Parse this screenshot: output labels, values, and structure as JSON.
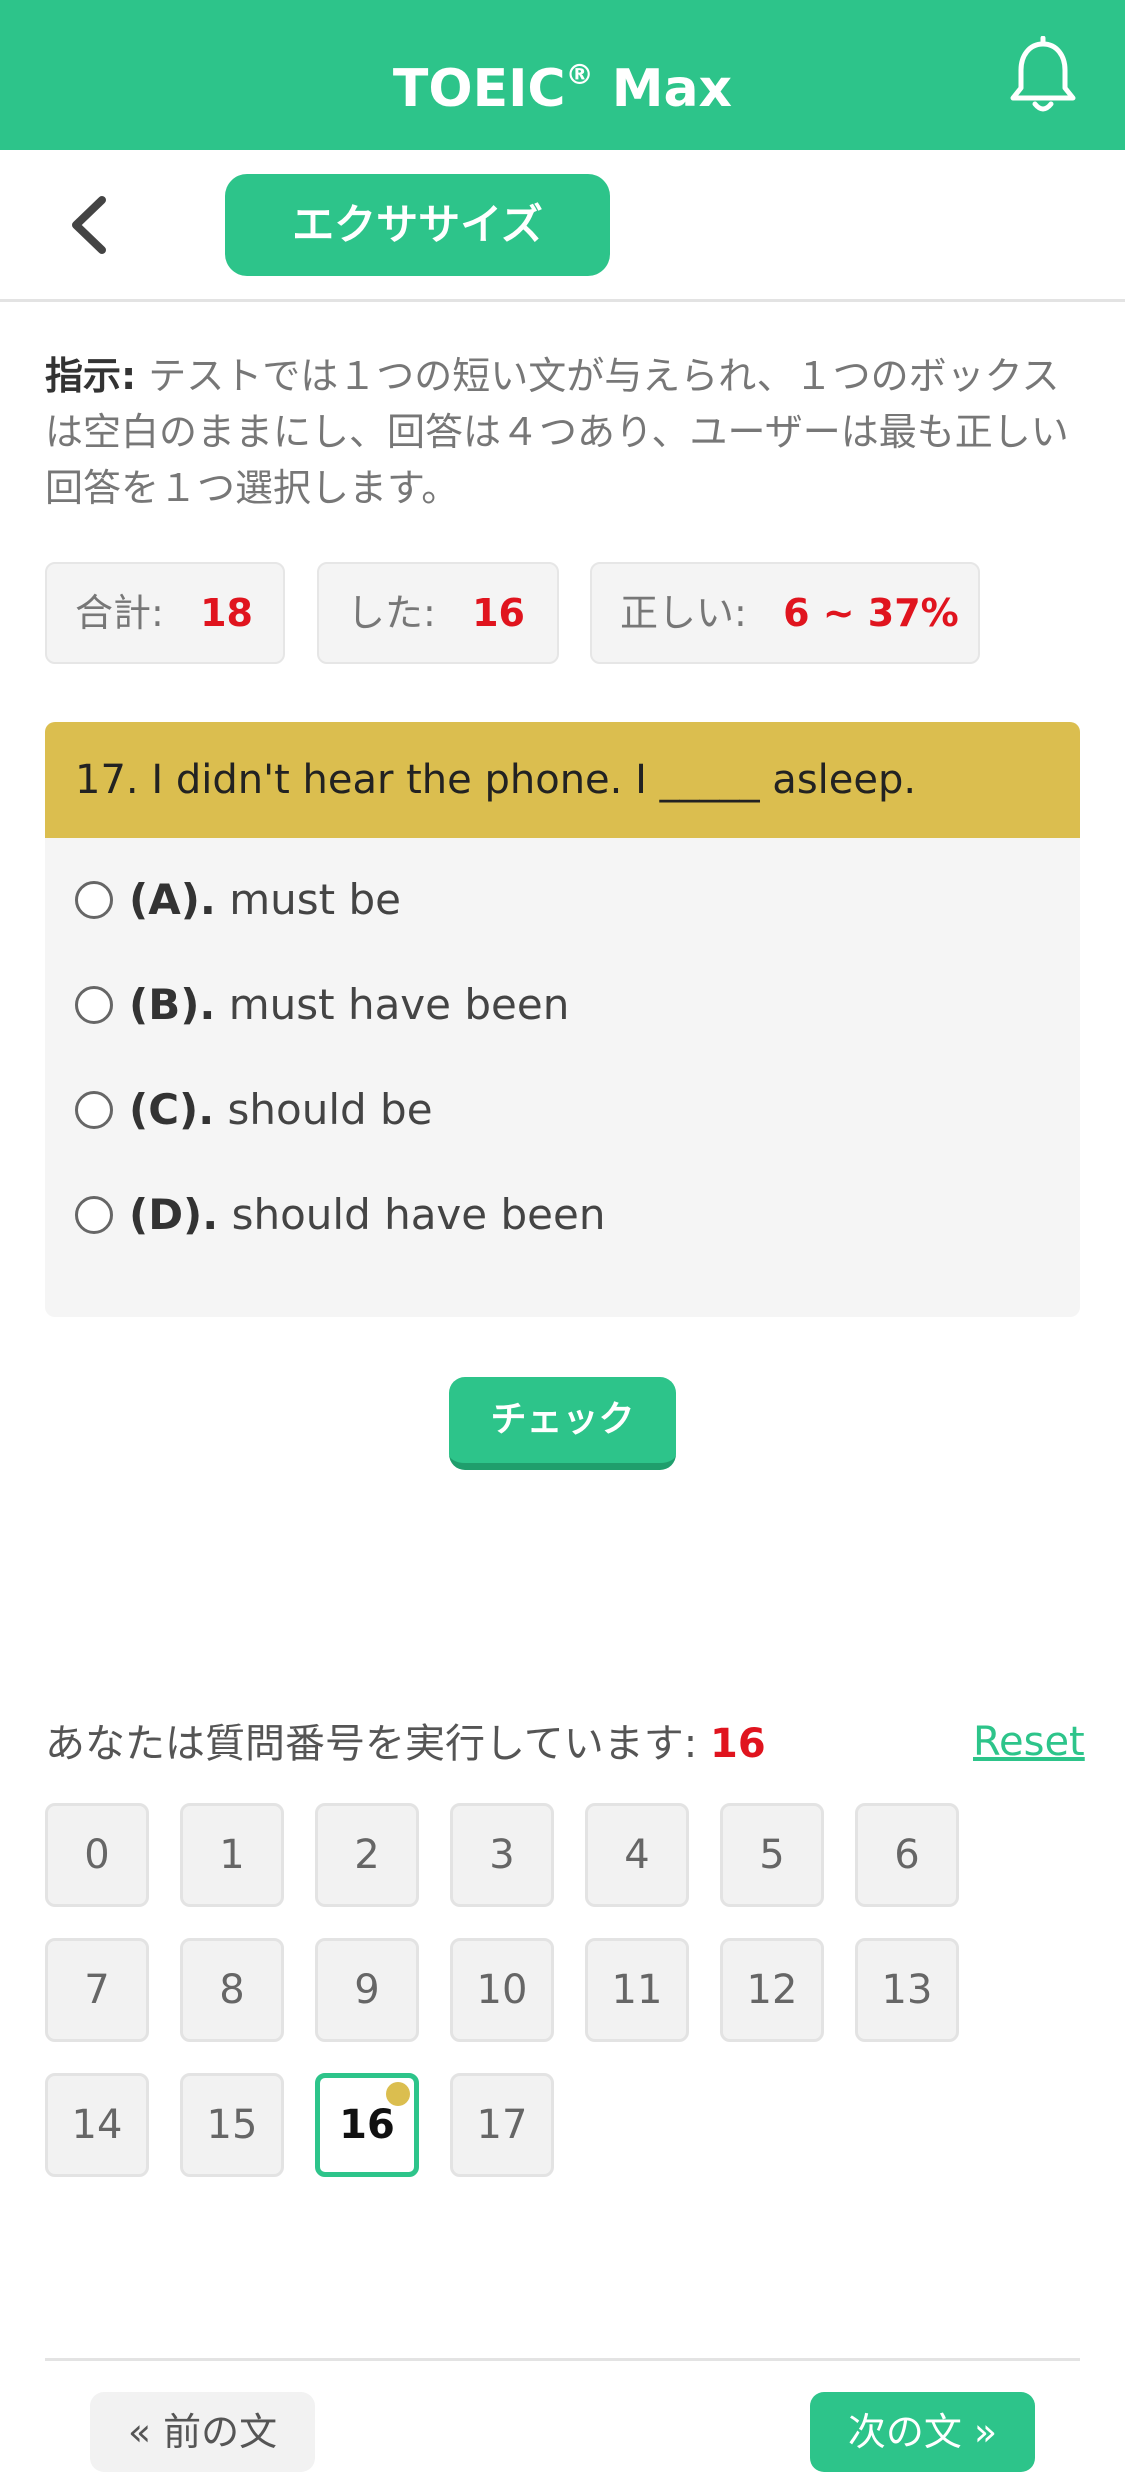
{
  "header": {
    "title": "TOEIC",
    "title_mark": "®",
    "title_suffix": " Max",
    "bell_icon": "bell-icon",
    "color": "#2dc48a"
  },
  "subbar": {
    "back_icon": "chevron-left-icon",
    "tab_label": "エクササイズ"
  },
  "instructions": {
    "label": "指示:",
    "text": " テストでは１つの短い文が与えられ、１つのボックスは空白のままにし、回答は４つあり、ユーザーは最も正しい回答を１つ選択します。"
  },
  "stats": {
    "total_label": "合計:",
    "total_value": "18",
    "done_label": "した:",
    "done_value": "16",
    "correct_label": "正しい:",
    "correct_value": "6 ~ 37%"
  },
  "question": {
    "text": "17. I didn't hear the phone. I _____ asleep.",
    "header_color": "#dbbe4f",
    "options": [
      {
        "key": "(A).",
        "text": "must be"
      },
      {
        "key": "(B).",
        "text": "must have been"
      },
      {
        "key": "(C).",
        "text": "should be"
      },
      {
        "key": "(D).",
        "text": "should have been"
      }
    ]
  },
  "check_label": "チェック",
  "progress": {
    "running_label": "あなたは質問番号を実行しています:",
    "current": "16",
    "reset_label": "Reset",
    "numbers": [
      "0",
      "1",
      "2",
      "3",
      "4",
      "5",
      "6",
      "7",
      "8",
      "9",
      "10",
      "11",
      "12",
      "13",
      "14",
      "15",
      "16",
      "17"
    ]
  },
  "nav": {
    "prev_label": "« 前の文",
    "next_label": "次の文 »"
  }
}
